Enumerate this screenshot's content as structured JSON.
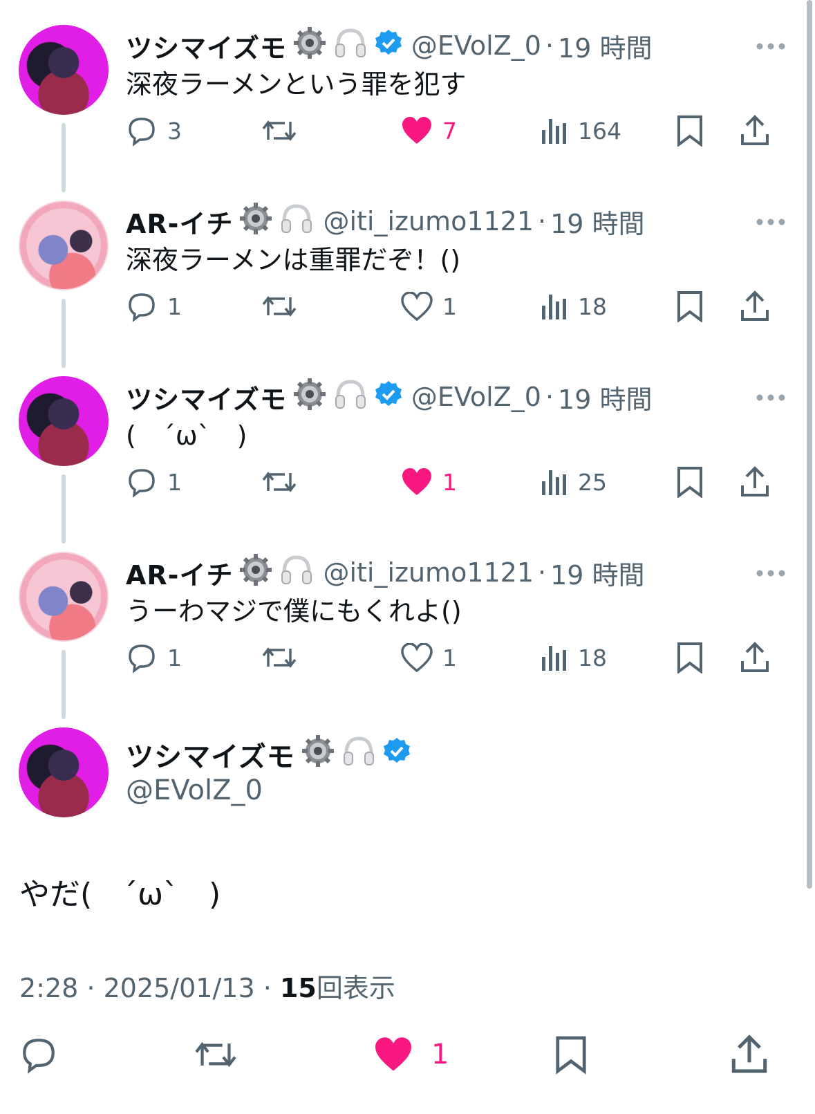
{
  "colors": {
    "like_pink": "#f91880",
    "verified_blue": "#1d9bf0",
    "muted": "#536471",
    "text": "#0f1419",
    "thread_line": "#cfd9de"
  },
  "icons": {
    "reply": "reply-icon",
    "retweet": "retweet-icon",
    "like": "heart-icon",
    "views": "views-bar-chart-icon",
    "bookmark": "bookmark-icon",
    "share": "share-upload-icon",
    "more": "more-dots-icon",
    "gear": "gear-emoji",
    "headphones": "headphones-emoji",
    "verified": "verified-badge-icon"
  },
  "replies": [
    {
      "name": "ツシマイズモ",
      "handle": "@EVolZ_0",
      "time": "19 時間",
      "verified": true,
      "text": "深夜ラーメンという罪を犯す",
      "reply_count": "3",
      "like_count": "7",
      "liked": true,
      "views": "164"
    },
    {
      "name": "AR-イチ",
      "handle": "@iti_izumo1121",
      "time": "19 時間",
      "verified": false,
      "text": "深夜ラーメンは重罪だぞ！()",
      "reply_count": "1",
      "like_count": "1",
      "liked": false,
      "views": "18"
    },
    {
      "name": "ツシマイズモ",
      "handle": "@EVolZ_0",
      "time": "19 時間",
      "verified": true,
      "text": "(　´ω`　)",
      "reply_count": "1",
      "like_count": "1",
      "liked": true,
      "views": "25"
    },
    {
      "name": "AR-イチ",
      "handle": "@iti_izumo1121",
      "time": "19 時間",
      "verified": false,
      "text": "うーわマジで僕にもくれよ()",
      "reply_count": "1",
      "like_count": "1",
      "liked": false,
      "views": "18"
    }
  ],
  "focus": {
    "name": "ツシマイズモ",
    "handle": "@EVolZ_0",
    "text": "やだ(　´ω`　)",
    "time": "2:28",
    "date": "2025/01/13",
    "views_count": "15",
    "views_label": "回表示",
    "like_count": "1"
  },
  "separator": "·"
}
